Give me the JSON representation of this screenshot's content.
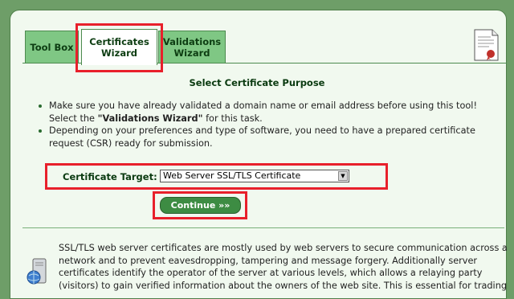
{
  "tabs": [
    {
      "label": "Tool Box"
    },
    {
      "label": "Certificates\nWizard"
    },
    {
      "label": "Validations\nWizard"
    }
  ],
  "icons": {
    "certificate": "certificate-document-icon",
    "server": "server-globe-icon"
  },
  "colors": {
    "background": "#6e9e68",
    "tab": "#7fc784",
    "button": "#3d8c43",
    "highlight": "#e8202b"
  },
  "page_title": "Select Certificate Purpose",
  "bullets": {
    "b1_pre": "Make sure you have already validated a domain name or email address before using this tool! Select the ",
    "b1_bold": "\"Validations Wizard\"",
    "b1_post": " for this task.",
    "b2": "Depending on your preferences and type of software, you need to have a prepared certificate request (CSR) ready for submission."
  },
  "form": {
    "target_label": "Certificate Target:",
    "target_value": "Web Server SSL/TLS Certificate",
    "continue_label": "Continue »»"
  },
  "description": "SSL/TLS web server certificates are mostly used by web servers to secure communication across a network and to prevent eavesdropping, tampering and message forgery. Additionally server certificates identify the operator of the server at various levels, which allows a relaying party (visitors) to gain verified information about the owners of the web site. This is essential for trading"
}
